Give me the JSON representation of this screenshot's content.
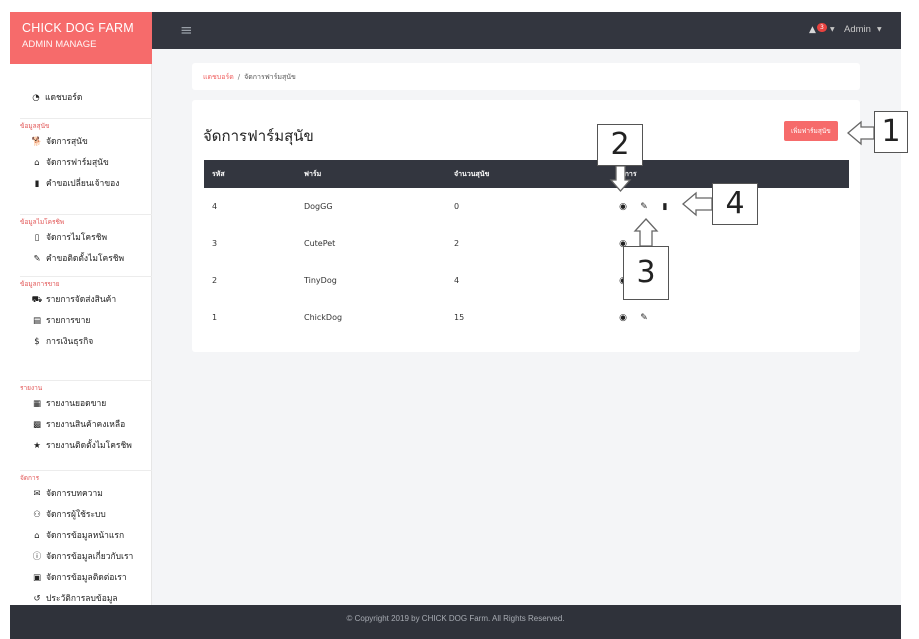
{
  "brand": {
    "title": "CHICK DOG FARM",
    "subtitle": "ADMIN MANAGE"
  },
  "topbar": {
    "notification_count": "3",
    "user_label": "Admin"
  },
  "sidebar": {
    "dashboard": "แดชบอร์ด",
    "sections": [
      {
        "heading": "ข้อมูลสุนัข",
        "items": [
          {
            "icon": "dog-icon",
            "glyph": "🐕",
            "label": "จัดการสุนัข"
          },
          {
            "icon": "warehouse-icon",
            "glyph": "⌂",
            "label": "จัดการฟาร์มสุนัข"
          },
          {
            "icon": "bookmark-icon",
            "glyph": "▮",
            "label": "คำขอเปลี่ยนเจ้าของ"
          }
        ]
      },
      {
        "heading": "ข้อมูลไมโครชิพ",
        "items": [
          {
            "icon": "sim-card-icon",
            "glyph": "▯",
            "label": "จัดการไมโครชิพ"
          },
          {
            "icon": "pen-icon",
            "glyph": "✎",
            "label": "คำขอติดตั้งไมโครชิพ"
          }
        ]
      },
      {
        "heading": "ข้อมูลการขาย",
        "items": [
          {
            "icon": "truck-icon",
            "glyph": "⛟",
            "label": "รายการจัดส่งสินค้า"
          },
          {
            "icon": "cash-register-icon",
            "glyph": "▤",
            "label": "รายการขาย"
          },
          {
            "icon": "dollar-icon",
            "glyph": "$",
            "label": "การเงินธุรกิจ"
          }
        ]
      },
      {
        "heading": "รายงาน",
        "items": [
          {
            "icon": "file-icon",
            "glyph": "▦",
            "label": "รายงานยอดขาย"
          },
          {
            "icon": "boxes-icon",
            "glyph": "▩",
            "label": "รายงานสินค้าคงเหลือ"
          },
          {
            "icon": "star-icon",
            "glyph": "★",
            "label": "รายงานติดตั้งไมโครชิพ"
          }
        ]
      },
      {
        "heading": "จัดการ",
        "items": [
          {
            "icon": "envelope-icon",
            "glyph": "✉",
            "label": "จัดการบทความ"
          },
          {
            "icon": "users-icon",
            "glyph": "⚇",
            "label": "จัดการผู้ใช้ระบบ"
          },
          {
            "icon": "home-icon",
            "glyph": "⌂",
            "label": "จัดการข้อมูลหน้าแรก"
          },
          {
            "icon": "info-circle-icon",
            "glyph": "ⓘ",
            "label": "จัดการข้อมูลเกี่ยวกับเรา"
          },
          {
            "icon": "address-card-icon",
            "glyph": "▣",
            "label": "จัดการข้อมูลติดต่อเรา"
          },
          {
            "icon": "history-icon",
            "glyph": "↺",
            "label": "ประวัติการลบข้อมูล"
          }
        ]
      }
    ]
  },
  "breadcrumb": {
    "home": "แดชบอร์ด",
    "separator": "/",
    "current": "จัดการฟาร์มสุนัข"
  },
  "main": {
    "title": "จัดการฟาร์มสุนัข",
    "add_button": "เพิ่มฟาร์มสุนัข",
    "table": {
      "headers": [
        "รหัส",
        "ฟาร์ม",
        "จำนวนสุนัข",
        "จัดการ"
      ],
      "rows": [
        {
          "id": "4",
          "farm": "DogGG",
          "count": "0",
          "delete": true
        },
        {
          "id": "3",
          "farm": "CutePet",
          "count": "2",
          "delete": false
        },
        {
          "id": "2",
          "farm": "TinyDog",
          "count": "4",
          "delete": false
        },
        {
          "id": "1",
          "farm": "ChickDog",
          "count": "15",
          "delete": false
        }
      ]
    }
  },
  "footer": {
    "text": "© Copyright 2019 by CHICK DOG Farm. All Rights Reserved."
  },
  "annotations": [
    "1",
    "2",
    "3",
    "4"
  ]
}
